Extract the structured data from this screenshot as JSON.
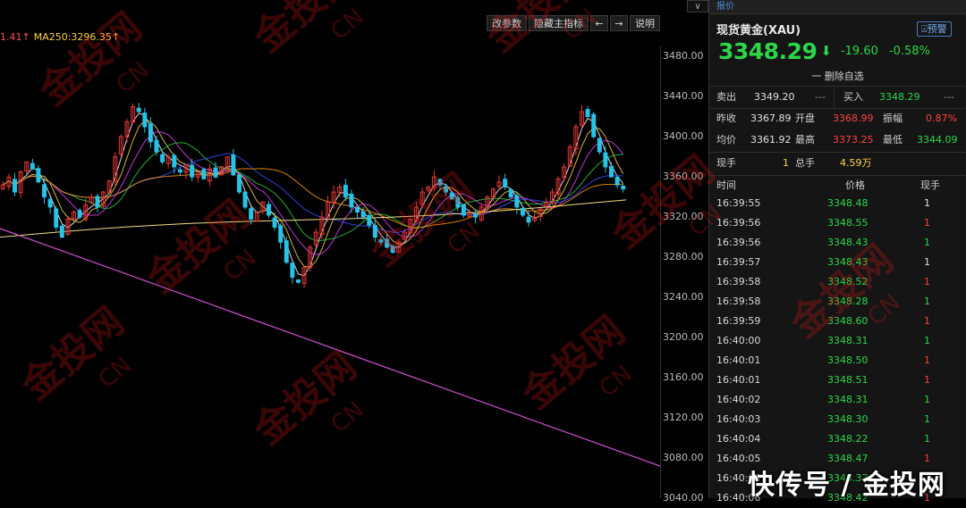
{
  "chart": {
    "ma_legend": {
      "part1": "1.41↑",
      "part2": "MA250:3296.35↑"
    },
    "toolbar": {
      "params": "改参数",
      "hide_main": "隐藏主指标",
      "left": "←",
      "right": "→",
      "help": "说明"
    },
    "corner": "∨",
    "y_axis_ticks": [
      "3480.00",
      "3440.00",
      "3400.00",
      "3360.00",
      "3320.00",
      "3280.00",
      "3240.00",
      "3200.00",
      "3160.00",
      "3120.00",
      "3080.00",
      "3040.00"
    ],
    "colors": {
      "up": "#e53935",
      "down": "#27c3e8",
      "ma1": "#ffffff",
      "ma2": "#ffd24a",
      "ma3": "#e040fb",
      "ma4": "#2ecc40",
      "ma5": "#3a4dff",
      "ma6": "#ff9800",
      "trend": "#d050d0"
    }
  },
  "chart_data": {
    "type": "candlestick",
    "ylim": [
      3040,
      3490
    ],
    "y_ticks": [
      3480,
      3440,
      3400,
      3360,
      3320,
      3280,
      3240,
      3200,
      3160,
      3120,
      3080,
      3040
    ],
    "close": [
      3352,
      3360,
      3345,
      3365,
      3375,
      3368,
      3355,
      3340,
      3330,
      3310,
      3300,
      3318,
      3325,
      3320,
      3332,
      3340,
      3330,
      3345,
      3356,
      3380,
      3400,
      3415,
      3430,
      3425,
      3410,
      3395,
      3385,
      3375,
      3380,
      3370,
      3365,
      3372,
      3360,
      3365,
      3358,
      3368,
      3360,
      3370,
      3380,
      3362,
      3345,
      3330,
      3318,
      3325,
      3335,
      3322,
      3310,
      3295,
      3275,
      3260,
      3255,
      3270,
      3290,
      3305,
      3320,
      3335,
      3345,
      3350,
      3340,
      3330,
      3325,
      3320,
      3312,
      3300,
      3295,
      3290,
      3285,
      3295,
      3305,
      3318,
      3330,
      3345,
      3350,
      3360,
      3352,
      3345,
      3338,
      3330,
      3322,
      3325,
      3320,
      3330,
      3340,
      3348,
      3355,
      3350,
      3340,
      3330,
      3322,
      3315,
      3320,
      3328,
      3335,
      3345,
      3358,
      3370,
      3390,
      3410,
      3425,
      3420,
      3400,
      3385,
      3370,
      3360,
      3352,
      3348
    ],
    "ma250_last": 3296.35
  },
  "panel": {
    "top_tab": "报价",
    "name": "现货黄金(XAU)",
    "alert": "预警",
    "price": "3348.29",
    "price_arrow": "⬇",
    "change": "-19.60",
    "change_pct": "-0.58%",
    "watch_action": "一 删除自选",
    "sell_label": "卖出",
    "sell_price": "3349.20",
    "sell_extra": "---",
    "buy_label": "买入",
    "buy_price": "3348.29",
    "buy_extra": "---",
    "prev_close_label": "昨收",
    "prev_close": "3367.89",
    "open_label": "开盘",
    "open": "3368.99",
    "amplitude_label": "振幅",
    "amplitude": "0.87%",
    "avg_label": "均价",
    "avg": "3361.92",
    "high_label": "最高",
    "high": "3373.25",
    "low_label": "最低",
    "low": "3344.09",
    "cur_vol_label": "现手",
    "cur_vol": "1",
    "total_vol_label": "总手",
    "total_vol": "4.59万",
    "tick_headers": {
      "time": "时间",
      "price": "价格",
      "vol": "现手"
    },
    "ticks": [
      {
        "time": "16:39:55",
        "price": "3348.48",
        "vol": "1",
        "vol_color": "#e0e0e0"
      },
      {
        "time": "16:39:56",
        "price": "3348.55",
        "vol": "1",
        "vol_color": "#ff4040"
      },
      {
        "time": "16:39:56",
        "price": "3348.43",
        "vol": "1",
        "vol_color": "#2cd54a"
      },
      {
        "time": "16:39:57",
        "price": "3348.43",
        "vol": "1",
        "vol_color": "#e0e0e0"
      },
      {
        "time": "16:39:58",
        "price": "3348.52",
        "vol": "1",
        "vol_color": "#ff4040"
      },
      {
        "time": "16:39:58",
        "price": "3348.28",
        "vol": "1",
        "vol_color": "#2cd54a"
      },
      {
        "time": "16:39:59",
        "price": "3348.60",
        "vol": "1",
        "vol_color": "#ff4040"
      },
      {
        "time": "16:40:00",
        "price": "3348.31",
        "vol": "1",
        "vol_color": "#2cd54a"
      },
      {
        "time": "16:40:01",
        "price": "3348.50",
        "vol": "1",
        "vol_color": "#ff4040"
      },
      {
        "time": "16:40:01",
        "price": "3348.51",
        "vol": "1",
        "vol_color": "#ff4040"
      },
      {
        "time": "16:40:02",
        "price": "3348.31",
        "vol": "1",
        "vol_color": "#2cd54a"
      },
      {
        "time": "16:40:03",
        "price": "3348.30",
        "vol": "1",
        "vol_color": "#2cd54a"
      },
      {
        "time": "16:40:04",
        "price": "3348.22",
        "vol": "1",
        "vol_color": "#2cd54a"
      },
      {
        "time": "16:40:05",
        "price": "3348.47",
        "vol": "1",
        "vol_color": "#ff4040"
      },
      {
        "time": "16:40:05",
        "price": "3348.37",
        "vol": "1",
        "vol_color": "#2cd54a"
      },
      {
        "time": "16:40:06",
        "price": "3348.42",
        "vol": "1",
        "vol_color": "#ff4040"
      }
    ]
  },
  "watermark": {
    "footer": "快传号 / 金投网",
    "tile_text": "金投网",
    "tile_sub": "CN"
  }
}
